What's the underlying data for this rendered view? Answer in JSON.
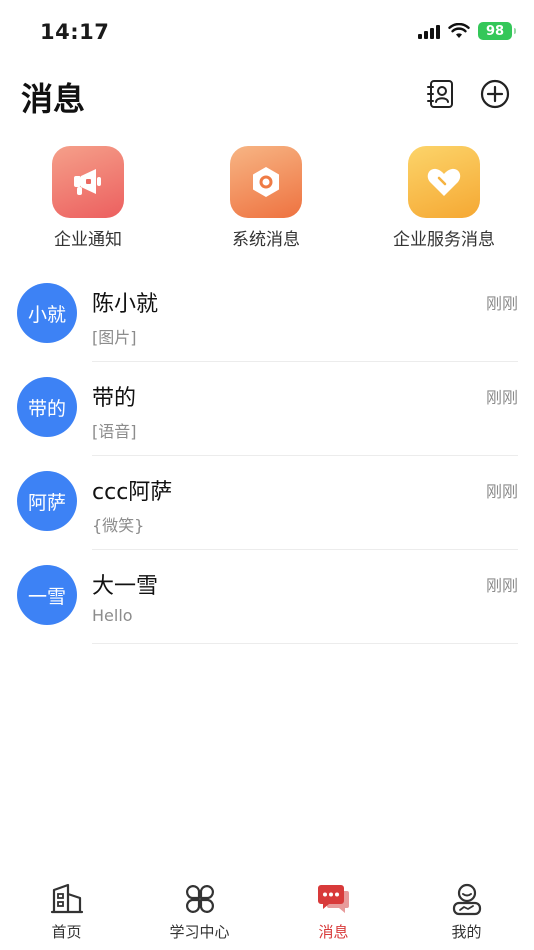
{
  "status_bar": {
    "time": "14:17",
    "battery": "98"
  },
  "header": {
    "title": "消息",
    "contacts_icon": "contacts-book-icon",
    "add_icon": "plus-circle-icon"
  },
  "quick_entries": [
    {
      "label": "企业通知",
      "icon": "megaphone-icon",
      "color_from": "#f5a08a",
      "color_to": "#ec5f5f"
    },
    {
      "label": "系统消息",
      "icon": "hexagon-nut-icon",
      "color_from": "#f7b584",
      "color_to": "#ee7240"
    },
    {
      "label": "企业服务消息",
      "icon": "heart-icon",
      "color_from": "#fcd46a",
      "color_to": "#f5a833"
    }
  ],
  "conversations": [
    {
      "avatar_text": "小就",
      "name": "陈小就",
      "preview": "[图片]",
      "time": "刚刚"
    },
    {
      "avatar_text": "带的",
      "name": "带的",
      "preview": "[语音]",
      "time": "刚刚"
    },
    {
      "avatar_text": "阿萨",
      "name": "ccc阿萨",
      "preview": "{微笑}",
      "time": "刚刚"
    },
    {
      "avatar_text": "一雪",
      "name": "大一雪",
      "preview": "Hello",
      "time": "刚刚"
    }
  ],
  "tab_bar": {
    "items": [
      {
        "label": "首页",
        "icon": "building-icon"
      },
      {
        "label": "学习中心",
        "icon": "four-petal-grid-icon"
      },
      {
        "label": "消息",
        "icon": "chat-bubbles-icon",
        "active": true
      },
      {
        "label": "我的",
        "icon": "user-profile-icon"
      }
    ],
    "active_color": "#d83a3a"
  },
  "colors": {
    "avatar_blue": "#3d82f5",
    "battery_green": "#34c759"
  }
}
